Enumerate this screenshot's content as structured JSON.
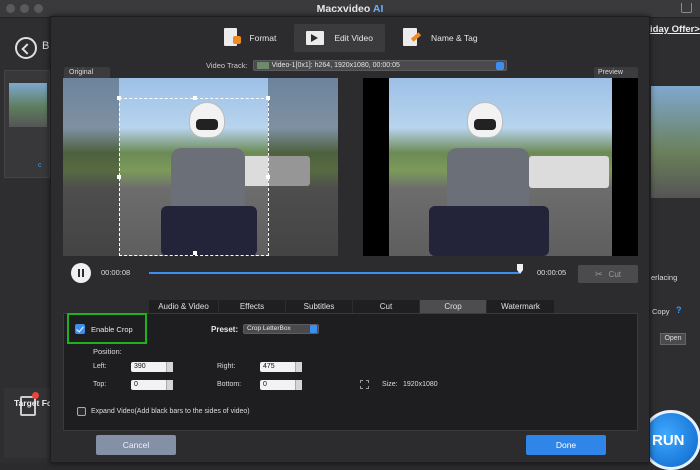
{
  "window": {
    "title_main": "Macxvideo",
    "title_accent": "AI"
  },
  "background": {
    "back_letter": "B",
    "offer_text": "iday Offer>",
    "target_label": "Target Fo",
    "thumb_caption": "c",
    "interlacing_text": "erlacing",
    "copy_text": "Copy",
    "help_text": "?",
    "open_label": "Open",
    "run_label": "RUN"
  },
  "modal": {
    "tabs": [
      {
        "label": "Format",
        "icon": "format-icon"
      },
      {
        "label": "Edit Video",
        "icon": "edit-video-icon"
      },
      {
        "label": "Name & Tag",
        "icon": "name-tag-icon"
      }
    ],
    "active_tab": "Edit Video",
    "video_track_label": "Video Track:",
    "video_track_value": "Video-1[0x1]: h264, 1920x1080, 00:00:05",
    "original_label": "Original",
    "preview_label": "Preview",
    "time_current": "00:00:08",
    "time_end": "00:00:05",
    "cut_label": "Cut",
    "playback_progress": 0.99,
    "sub_tabs": [
      "Audio & Video",
      "Effects",
      "Subtitles",
      "Cut",
      "Crop",
      "Watermark"
    ],
    "active_sub_tab": "Crop",
    "crop": {
      "enable_label": "Enable Crop",
      "enabled": true,
      "preset_label": "Preset:",
      "preset_value": "Crop LetterBox",
      "position_label": "Position:",
      "left_label": "Left:",
      "left_value": "390",
      "right_label": "Right:",
      "right_value": "475",
      "top_label": "Top:",
      "top_value": "0",
      "bottom_label": "Bottom:",
      "bottom_value": "0",
      "size_label": "Size:",
      "size_value": "1920x1080",
      "expand_label": "Expand Video(Add black bars to the sides of video)",
      "expand_checked": false
    },
    "cancel_label": "Cancel",
    "done_label": "Done"
  },
  "colors": {
    "accent": "#3c8ef0",
    "done_button": "#2f86e8",
    "cancel_button": "#8390a5",
    "highlight_box": "#1cb21c",
    "title_ai": "#6db0ff"
  }
}
